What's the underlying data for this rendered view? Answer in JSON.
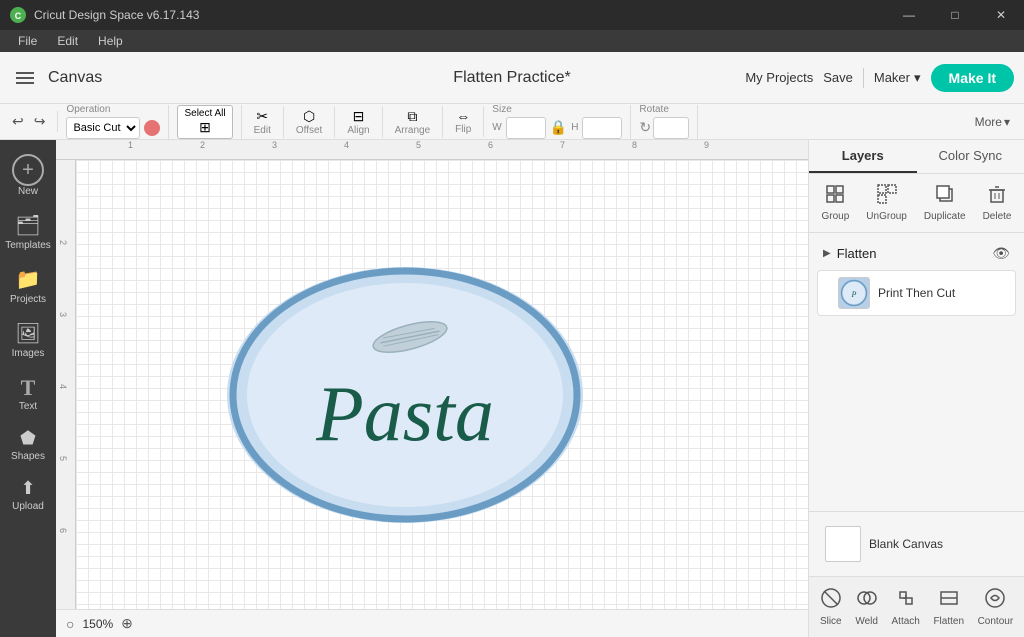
{
  "titlebar": {
    "app_name": "Cricut Design Space  v6.17.143",
    "minimize": "—",
    "maximize": "□",
    "close": "✕"
  },
  "menubar": {
    "items": [
      "File",
      "Edit",
      "Help"
    ]
  },
  "toolbar": {
    "canvas_label": "Canvas",
    "project_title": "Flatten Practice*",
    "my_projects": "My Projects",
    "save": "Save",
    "maker": "Maker",
    "make_it": "Make It"
  },
  "toolbar2": {
    "operation_label": "Operation",
    "operation_value": "Basic Cut",
    "select_all": "Select All",
    "edit": "Edit",
    "offset": "Offset",
    "align": "Align",
    "arrange": "Arrange",
    "flip": "Flip",
    "size_label": "Size",
    "w_label": "W",
    "h_label": "H",
    "rotate_label": "Rotate",
    "more": "More"
  },
  "sidebar": {
    "items": [
      {
        "label": "New",
        "icon": "+"
      },
      {
        "label": "Templates",
        "icon": "🗂"
      },
      {
        "label": "Projects",
        "icon": "📁"
      },
      {
        "label": "Images",
        "icon": "🖼"
      },
      {
        "label": "Text",
        "icon": "T"
      },
      {
        "label": "Shapes",
        "icon": "⬟"
      },
      {
        "label": "Upload",
        "icon": "⬆"
      }
    ]
  },
  "canvas": {
    "zoom_label": "150%",
    "ruler_numbers_top": [
      "1",
      "2",
      "3",
      "4",
      "5",
      "6",
      "7",
      "8",
      "9"
    ],
    "ruler_numbers_left": [
      "2",
      "3",
      "4",
      "5",
      "6"
    ]
  },
  "right_panel": {
    "tabs": [
      {
        "label": "Layers",
        "active": true
      },
      {
        "label": "Color Sync",
        "active": false
      }
    ],
    "actions": [
      {
        "label": "Group",
        "disabled": false
      },
      {
        "label": "UnGroup",
        "disabled": false
      },
      {
        "label": "Duplicate",
        "disabled": false
      },
      {
        "label": "Delete",
        "disabled": false
      }
    ],
    "group_name": "Flatten",
    "layer_item": {
      "name": "Print Then Cut",
      "thumb_text": ""
    },
    "blank_canvas": "Blank Canvas",
    "bottom_tools": [
      {
        "label": "Slice"
      },
      {
        "label": "Weld"
      },
      {
        "label": "Attach"
      },
      {
        "label": "Flatten"
      },
      {
        "label": "Contour"
      }
    ]
  }
}
